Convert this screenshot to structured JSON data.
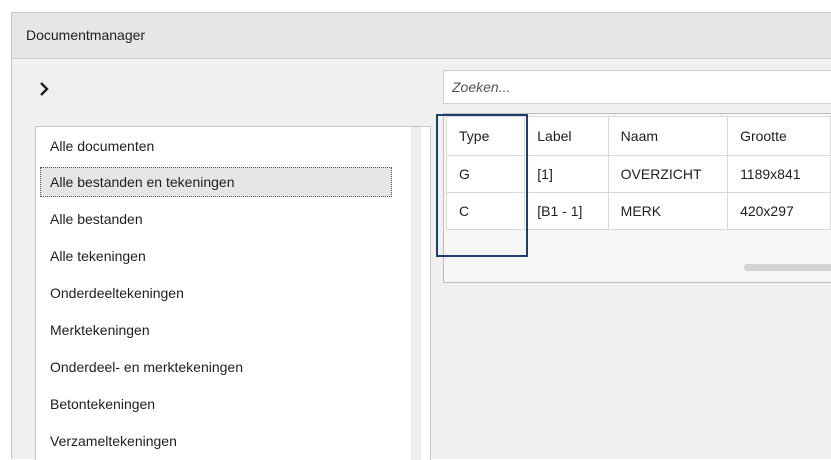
{
  "window": {
    "title": "Documentmanager"
  },
  "search": {
    "placeholder": "Zoeken...",
    "value": ""
  },
  "categories": [
    "Alle documenten",
    "Alle bestanden en tekeningen",
    "Alle bestanden",
    "Alle tekeningen",
    "Onderdeeltekeningen",
    "Merktekeningen",
    "Onderdeel- en merktekeningen",
    "Betontekeningen",
    "Verzameltekeningen"
  ],
  "selected_category": "Alle bestanden en tekeningen",
  "grid": {
    "columns": [
      "Type",
      "Label",
      "Naam",
      "Grootte"
    ],
    "rows": [
      [
        "G",
        "[1]",
        "OVERZICHT",
        "1189x841"
      ],
      [
        "C",
        "[B1 - 1]",
        "MERK",
        "420x297"
      ]
    ]
  },
  "colors": {
    "highlight_border": "#1f3e6e",
    "selected_background": "#e6e6e6"
  },
  "icons": {
    "expand": "chevron-right-icon"
  }
}
